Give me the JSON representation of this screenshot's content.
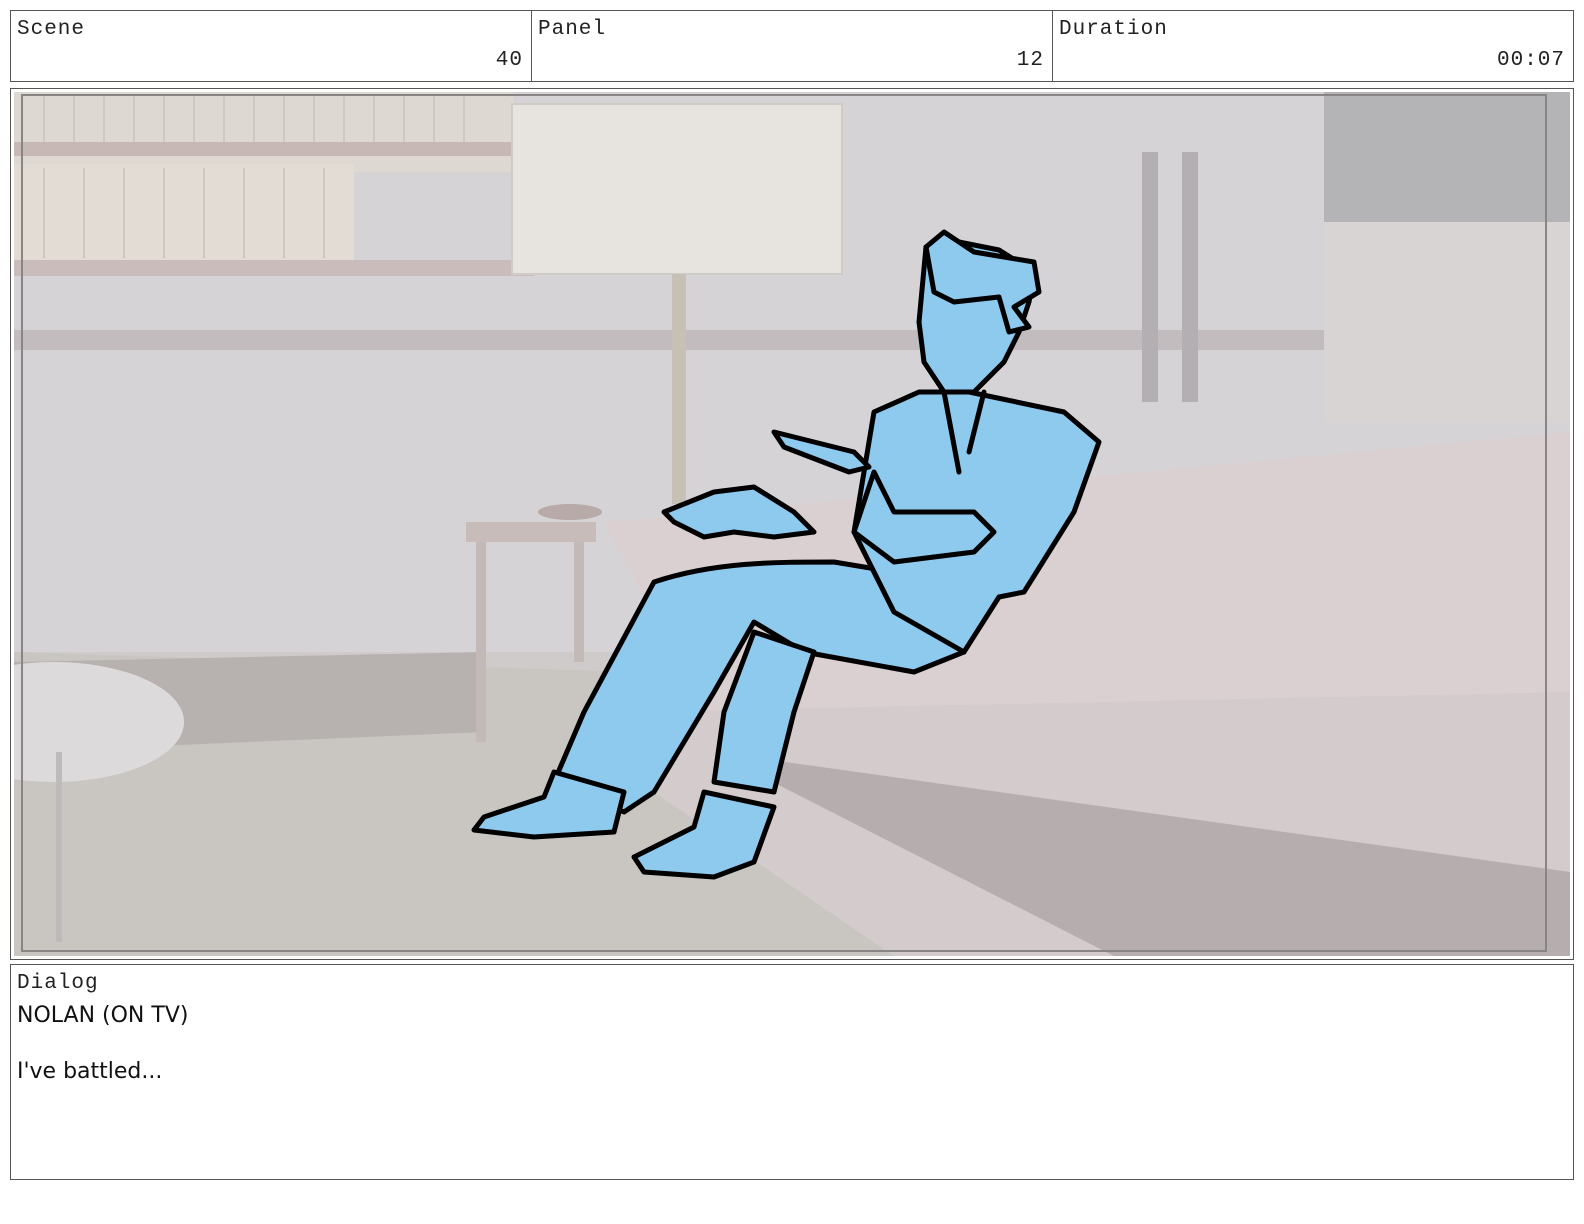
{
  "header": {
    "scene_label": "Scene",
    "scene_value": "40",
    "panel_label": "Panel",
    "panel_value": "12",
    "duration_label": "Duration",
    "duration_value": "00:07"
  },
  "dialog": {
    "label": "Dialog",
    "speaker": "NOLAN (ON TV)",
    "line": "I've battled..."
  },
  "colors": {
    "character_fill": "#8ec9ee",
    "room_tint": "#d2cdcd",
    "border": "#555555"
  }
}
